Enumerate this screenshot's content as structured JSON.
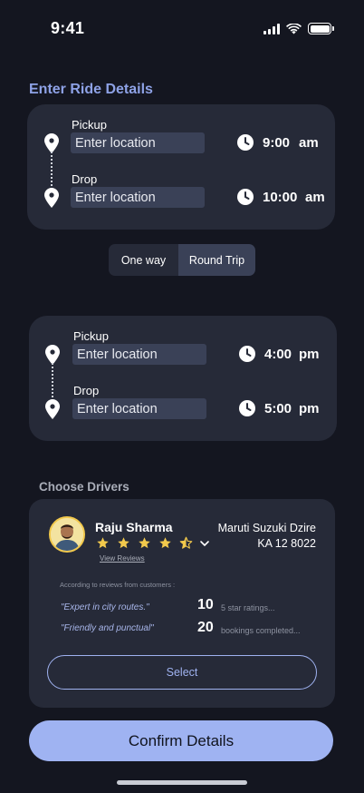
{
  "status_bar": {
    "time": "9:41"
  },
  "ride_details": {
    "title": "Enter Ride Details",
    "first_leg": {
      "pickup_label": "Pickup",
      "pickup_placeholder": "Enter location",
      "pickup_time": "9:00",
      "pickup_ampm": "am",
      "drop_label": "Drop",
      "drop_placeholder": "Enter location",
      "drop_time": "10:00",
      "drop_ampm": "am"
    },
    "trip_type": {
      "options": [
        "One way",
        "Round Trip"
      ],
      "selected": "Round Trip"
    },
    "return_leg": {
      "pickup_label": "Pickup",
      "pickup_placeholder": "Enter location",
      "pickup_time": "4:00",
      "pickup_ampm": "pm",
      "drop_label": "Drop",
      "drop_placeholder": "Enter location",
      "drop_time": "5:00",
      "drop_ampm": "pm"
    }
  },
  "drivers": {
    "title": "Choose Drivers",
    "driver": {
      "name": "Raju Sharma",
      "rating": 4.5,
      "view_reviews": "View Reviews",
      "car_model": "Maruti Suzuki Dzire",
      "car_plate": "KA 12 8022",
      "review_note": "According to reviews from customers :",
      "quotes": [
        "\"Expert in city routes.\"",
        "\"Friendly and punctual\""
      ],
      "stats": [
        {
          "value": "10",
          "label": "5 star ratings..."
        },
        {
          "value": "20",
          "label": "bookings completed..."
        }
      ],
      "select_label": "Select"
    }
  },
  "confirm_label": "Confirm Details",
  "colors": {
    "background": "#141620",
    "card": "#262a38",
    "input": "#3a4157",
    "accent": "#9fb3f2",
    "star": "#f2c94c"
  }
}
